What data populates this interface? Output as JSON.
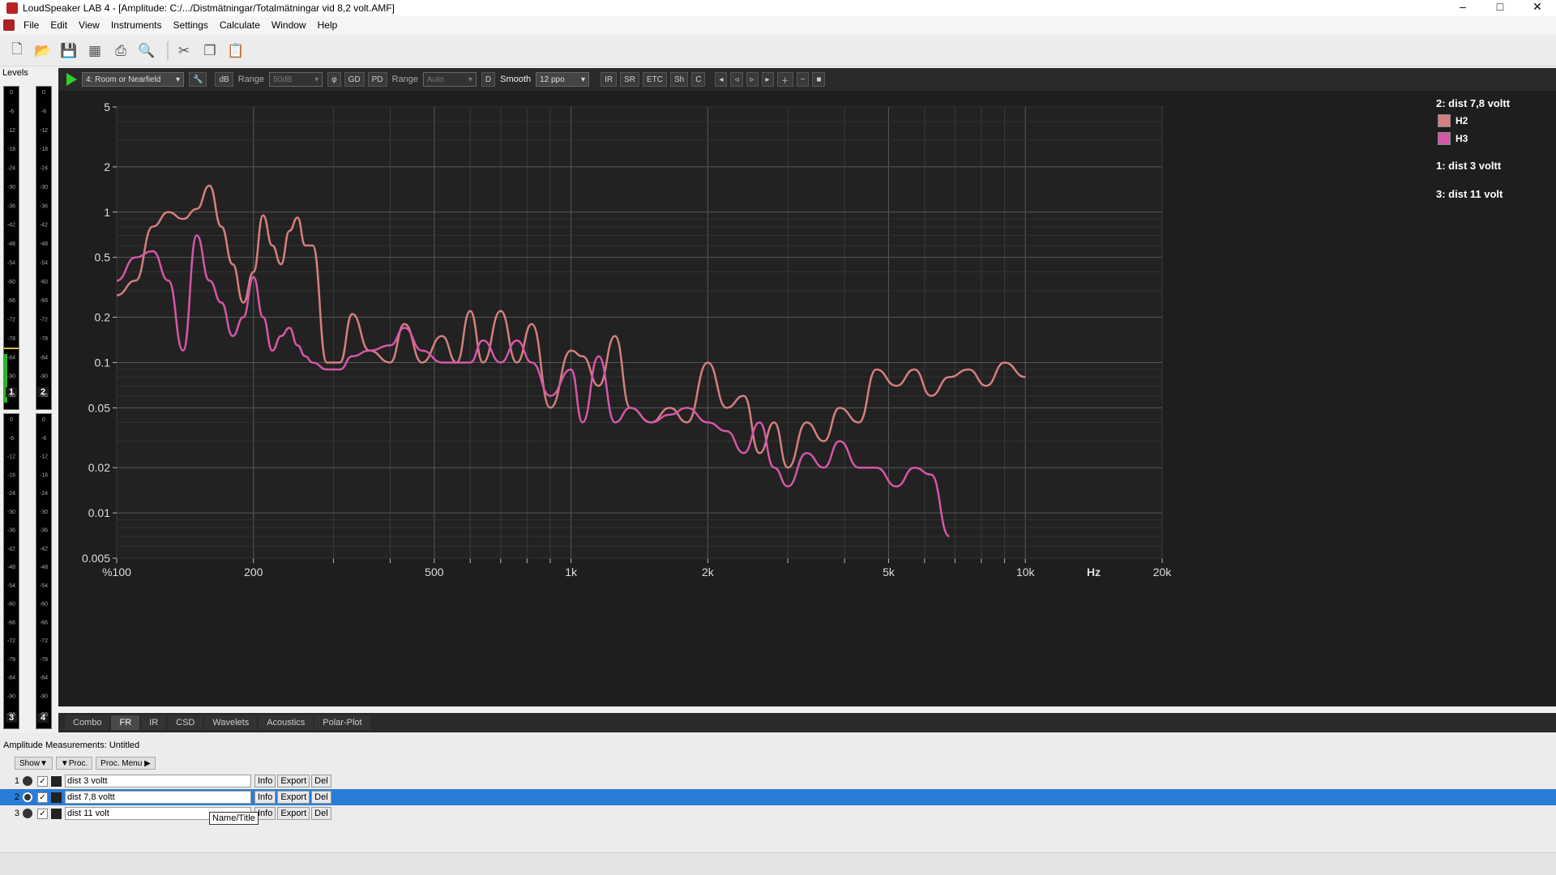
{
  "window": {
    "title": "LoudSpeaker LAB 4 - [Amplitude: C:/.../Distmätningar/Totalmätningar vid 8,2 volt.AMF]",
    "controls": [
      "–",
      "□",
      "✕"
    ]
  },
  "menu": [
    "File",
    "Edit",
    "View",
    "Instruments",
    "Settings",
    "Calculate",
    "Window",
    "Help"
  ],
  "toolbar_icons": [
    "new-icon",
    "open-icon",
    "save-icon",
    "save-all-icon",
    "print-icon",
    "print-preview-icon",
    "cut-icon",
    "copy-icon",
    "paste-icon"
  ],
  "levels": {
    "label": "Levels",
    "meter_a": [
      "1",
      "2"
    ],
    "meter_b": [
      "3",
      "4"
    ],
    "ticks": [
      "0",
      "-6",
      "-12",
      "-18",
      "-24",
      "-30",
      "-36",
      "-42",
      "-48",
      "-54",
      "-60",
      "-66",
      "-72",
      "-78",
      "-84",
      "-90",
      "-96"
    ]
  },
  "fr_toolbar": {
    "mode": "4: Room or Nearfield",
    "db_label": "dB",
    "range_label": "Range",
    "range_value": "50dB",
    "phase_label": "φ",
    "gd_label": "GD",
    "pd_label": "PD",
    "range2_label": "Range",
    "range2_value": "Auto",
    "d_label": "D",
    "smooth_label": "Smooth",
    "smooth_value": "12 ppo",
    "buttons": [
      "IR",
      "SR",
      "ETC",
      "Sh",
      "C"
    ]
  },
  "legend": {
    "groups": [
      {
        "title": "2: dist 7,8 voltt",
        "entries": [
          {
            "label": "H2",
            "color": "#d47f80"
          },
          {
            "label": "H3",
            "color": "#d457a8"
          }
        ]
      },
      {
        "title": "1: dist 3 voltt",
        "entries": []
      },
      {
        "title": "3: dist 11 volt",
        "entries": []
      }
    ]
  },
  "chart_data": {
    "type": "line",
    "x_scale": "log",
    "y_scale": "log",
    "xlim": [
      100,
      20000
    ],
    "ylim": [
      0.005,
      5
    ],
    "x_ticks": [
      "%100",
      "200",
      "500",
      "1k",
      "2k",
      "5k",
      "10k",
      "Hz",
      "20k"
    ],
    "y_ticks": [
      "5",
      "2",
      "1",
      "0.5",
      "0.2",
      "0.1",
      "0.05",
      "0.02",
      "0.01",
      "0.005"
    ],
    "series": [
      {
        "name": "H2",
        "color": "#d47f80",
        "x": [
          100,
          110,
          120,
          130,
          140,
          150,
          160,
          170,
          180,
          190,
          200,
          210,
          220,
          230,
          240,
          250,
          260,
          270,
          290,
          310,
          330,
          360,
          400,
          430,
          470,
          520,
          560,
          600,
          640,
          700,
          760,
          820,
          900,
          1000,
          1060,
          1150,
          1250,
          1350,
          1500,
          1650,
          1800,
          2000,
          2200,
          2400,
          2600,
          2800,
          3000,
          3300,
          3600,
          3900,
          4300,
          4700,
          5200,
          5700,
          6200,
          6800,
          7500,
          8200,
          9000,
          10000
        ],
        "y": [
          0.28,
          0.35,
          0.8,
          1.0,
          0.9,
          1.05,
          1.5,
          0.8,
          0.45,
          0.25,
          0.4,
          0.95,
          0.6,
          0.45,
          0.75,
          0.92,
          0.6,
          0.6,
          0.1,
          0.1,
          0.21,
          0.12,
          0.1,
          0.18,
          0.1,
          0.15,
          0.1,
          0.22,
          0.1,
          0.22,
          0.1,
          0.18,
          0.05,
          0.12,
          0.11,
          0.07,
          0.15,
          0.05,
          0.04,
          0.05,
          0.04,
          0.1,
          0.05,
          0.06,
          0.025,
          0.04,
          0.02,
          0.04,
          0.03,
          0.05,
          0.04,
          0.09,
          0.07,
          0.09,
          0.06,
          0.08,
          0.09,
          0.07,
          0.1,
          0.08
        ]
      },
      {
        "name": "H3",
        "color": "#d457a8",
        "x": [
          100,
          110,
          120,
          130,
          140,
          150,
          160,
          170,
          180,
          190,
          200,
          210,
          220,
          230,
          240,
          250,
          260,
          270,
          290,
          310,
          330,
          360,
          400,
          430,
          470,
          520,
          560,
          600,
          640,
          700,
          760,
          820,
          900,
          1000,
          1060,
          1150,
          1250,
          1350,
          1500,
          1650,
          1800,
          2000,
          2200,
          2400,
          2600,
          2800,
          3000,
          3300,
          3600,
          3900,
          4300,
          4700,
          5200,
          5700,
          6200,
          6800
        ],
        "y": [
          0.35,
          0.5,
          0.55,
          0.35,
          0.12,
          0.7,
          0.35,
          0.25,
          0.15,
          0.2,
          0.37,
          0.2,
          0.12,
          0.15,
          0.17,
          0.13,
          0.11,
          0.1,
          0.09,
          0.09,
          0.11,
          0.12,
          0.13,
          0.17,
          0.12,
          0.1,
          0.1,
          0.1,
          0.14,
          0.1,
          0.14,
          0.1,
          0.06,
          0.09,
          0.04,
          0.11,
          0.04,
          0.05,
          0.04,
          0.045,
          0.05,
          0.04,
          0.035,
          0.025,
          0.04,
          0.02,
          0.015,
          0.025,
          0.02,
          0.03,
          0.02,
          0.02,
          0.015,
          0.02,
          0.018,
          0.007
        ]
      }
    ]
  },
  "bottom_tabs": [
    "Combo",
    "FR",
    "IR",
    "CSD",
    "Wavelets",
    "Acoustics",
    "Polar-Plot"
  ],
  "measurements": {
    "title": "Amplitude Measurements: Untitled",
    "buttons": [
      "Show▼",
      "▼Proc.",
      "Proc. Menu ▶"
    ],
    "rows": [
      {
        "num": "1",
        "name": "dist 3 voltt",
        "checked": "✓"
      },
      {
        "num": "2",
        "name": "dist 7,8 voltt",
        "checked": "✓"
      },
      {
        "num": "3",
        "name": "dist 11 volt",
        "checked": "✓"
      }
    ],
    "row_buttons": [
      "Info",
      "Export",
      "Del"
    ],
    "tooltip": "Name/Title"
  }
}
